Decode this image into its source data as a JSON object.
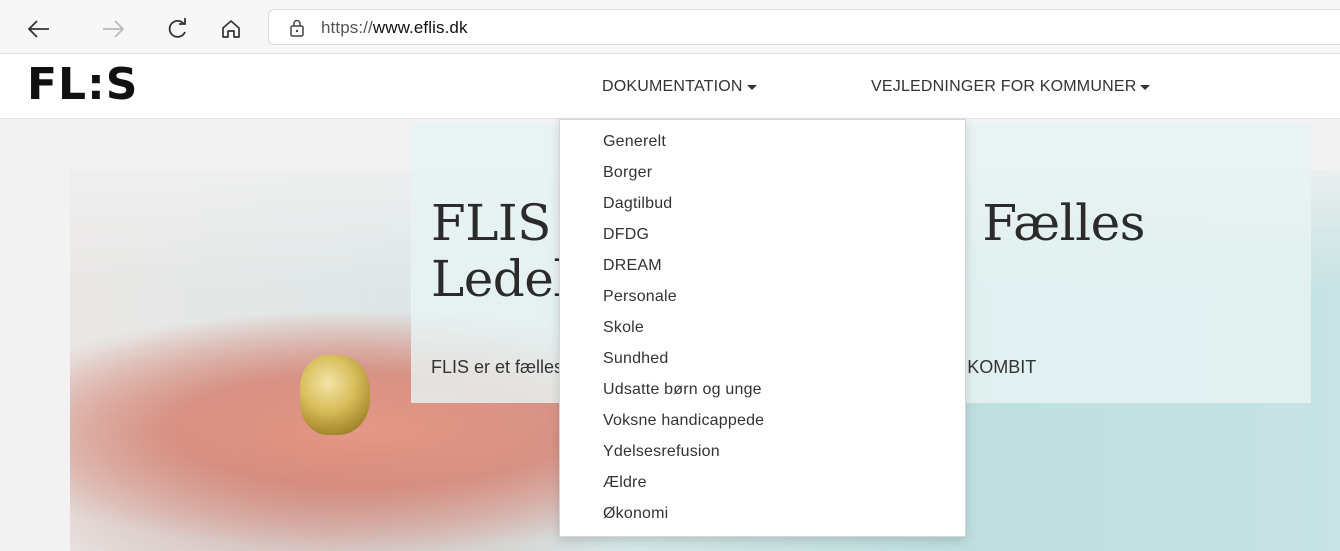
{
  "browser": {
    "url_prefix": "https://",
    "url_domain": "www.eflis.dk",
    "icons": [
      "back-arrow-icon",
      "forward-arrow-icon",
      "refresh-icon",
      "home-icon",
      "lock-icon"
    ]
  },
  "site": {
    "logo": "FL:S",
    "menu": [
      {
        "label": "DOKUMENTATION"
      },
      {
        "label": "VEJLEDNINGER FOR KOMMUNER"
      }
    ]
  },
  "hero": {
    "title_line1": "FLIS – Kommunernes Fælles",
    "title_line2": "Ledelsesinformation",
    "lead": "FLIS er et fælleskommunalt ledelsesinformationssystem, udbudt af KOMBIT"
  },
  "dropdown": {
    "items": [
      "Generelt",
      "Borger",
      "Dagtilbud",
      "DFDG",
      "DREAM",
      "Personale",
      "Skole",
      "Sundhed",
      "Udsatte børn og unge",
      "Voksne handicappede",
      "Ydelsesrefusion",
      "Ældre",
      "Økonomi"
    ]
  },
  "colors": {
    "page_bg": "#f2f2f2",
    "header_bg": "#ffffff",
    "text": "#333333",
    "logo": "#111111"
  }
}
